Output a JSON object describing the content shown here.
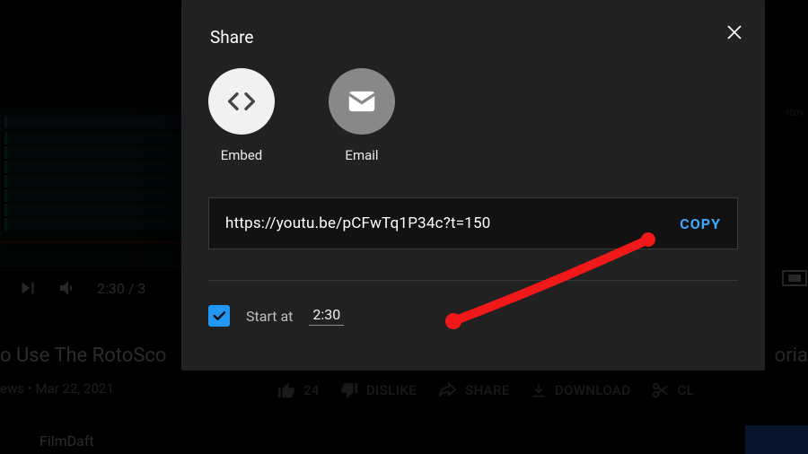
{
  "background": {
    "title_left": "o Use The RotoSco",
    "title_right": "oria",
    "meta": "ews • Mar 22, 2021",
    "playtime": "2:30 / 3",
    "pct_label": "100%",
    "channel": "FilmDaft",
    "actions": {
      "like_count": "24",
      "dislike": "DISLIKE",
      "share": "SHARE",
      "download": "DOWNLOAD",
      "clip": "CL"
    }
  },
  "dialog": {
    "title": "Share",
    "options": {
      "embed": "Embed",
      "email": "Email"
    },
    "url": "https://youtu.be/pCFwTq1P34c?t=150",
    "copy": "COPY",
    "start_at_label": "Start at",
    "start_at_value": "2:30"
  },
  "icons": {
    "close": "close-icon",
    "embed": "embed-icon",
    "email": "email-icon",
    "checkmark": "check-icon",
    "play_next": "play-next-icon",
    "volume": "volume-icon",
    "like": "thumb-up-icon",
    "dislike": "thumb-down-icon",
    "share": "share-arrow-icon",
    "download": "download-icon",
    "clip": "scissors-icon",
    "theater": "theater-icon"
  },
  "colors": {
    "dialog_bg": "#212121",
    "accent": "#3ea6ff",
    "checkbox": "#2196f3",
    "annotation": "#f01818"
  }
}
